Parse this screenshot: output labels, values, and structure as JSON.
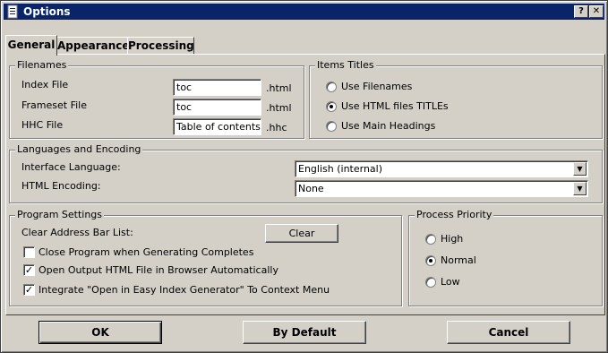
{
  "window": {
    "title": "Options",
    "help_btn": "?",
    "close_btn": "✕"
  },
  "tabs": [
    {
      "label": "General"
    },
    {
      "label": "Appearance"
    },
    {
      "label": "Processing"
    }
  ],
  "filenames": {
    "legend": "Filenames",
    "index_label": "Index File",
    "index_value": "toc",
    "index_ext": ".html",
    "frameset_label": "Frameset File",
    "frameset_value": "toc",
    "frameset_ext": ".html",
    "hhc_label": "HHC File",
    "hhc_value": "Table of contents",
    "hhc_ext": ".hhc"
  },
  "items_titles": {
    "legend": "Items Titles",
    "options": [
      {
        "label": "Use Filenames",
        "selected": false
      },
      {
        "label": "Use HTML files TITLEs",
        "selected": true
      },
      {
        "label": "Use Main Headings",
        "selected": false
      }
    ]
  },
  "languages": {
    "legend": "Languages and Encoding",
    "interface_label": "Interface Language:",
    "interface_value": "English (internal)",
    "encoding_label": "HTML Encoding:",
    "encoding_value": "None"
  },
  "program_settings": {
    "legend": "Program Settings",
    "clear_label": "Clear Address Bar List:",
    "clear_button": "Clear",
    "checks": [
      {
        "label": "Close Program when Generating Completes",
        "checked": false
      },
      {
        "label": "Open Output HTML File in Browser Automatically",
        "checked": true
      },
      {
        "label": "Integrate \"Open in Easy Index Generator\" To Context Menu",
        "checked": true
      }
    ]
  },
  "priority": {
    "legend": "Process Priority",
    "options": [
      {
        "label": "High",
        "selected": false
      },
      {
        "label": "Normal",
        "selected": true
      },
      {
        "label": "Low",
        "selected": false
      }
    ]
  },
  "buttons": {
    "ok": "OK",
    "default": "By Default",
    "cancel": "Cancel"
  }
}
